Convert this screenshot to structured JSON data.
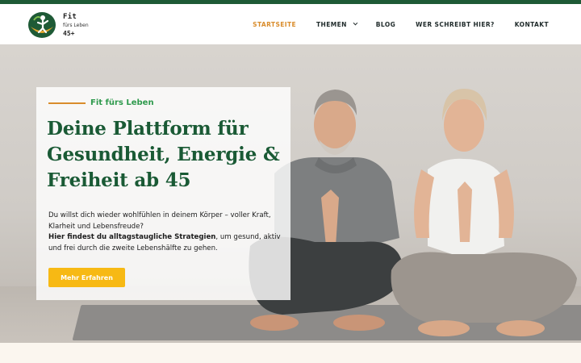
{
  "logo": {
    "line1": "Fit",
    "line2": "fürs Leben",
    "line3": "45+"
  },
  "nav": {
    "items": [
      {
        "label": "STARTSEITE",
        "active": true
      },
      {
        "label": "THEMEN",
        "has_dropdown": true
      },
      {
        "label": "BLOG"
      },
      {
        "label": "WER SCHREIBT HIER?"
      },
      {
        "label": "KONTAKT"
      }
    ]
  },
  "hero": {
    "eyebrow": "Fit fürs Leben",
    "headline": "Deine Plattform für Gesundheit, Energie & Freiheit ab 45",
    "body_line1": "Du willst dich wieder wohlfühlen in deinem Körper – voller Kraft, Klarheit und Lebensfreude?",
    "body_bold": "Hier findest du alltagstaugliche Strategien",
    "body_rest": ", um gesund, aktiv und frei durch die zweite Lebenshälfte zu gehen.",
    "cta_label": "Mehr Erfahren",
    "image_description_icon": "yoga-couple-photo"
  },
  "colors": {
    "brand_green": "#1a5a35",
    "accent_orange": "#d98c2b",
    "cta_yellow": "#f7b914",
    "eyebrow_green": "#2f9a4d"
  }
}
